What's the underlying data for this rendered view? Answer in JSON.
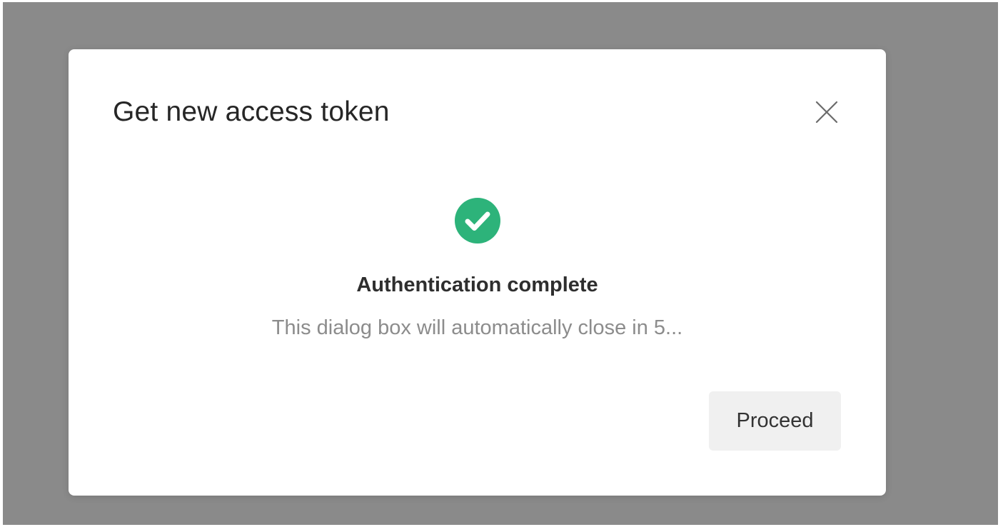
{
  "dialog": {
    "title": "Get new access token",
    "close_icon": "close-icon",
    "status": {
      "icon": "check-circle-icon",
      "icon_color": "#2db37a",
      "heading": "Authentication complete",
      "message": "This dialog box will automatically close in 5..."
    },
    "proceed_label": "Proceed"
  },
  "colors": {
    "overlay": "#8a8a8a",
    "dialog_background": "#ffffff",
    "button_background": "#f0f0f0",
    "success": "#2db37a"
  }
}
